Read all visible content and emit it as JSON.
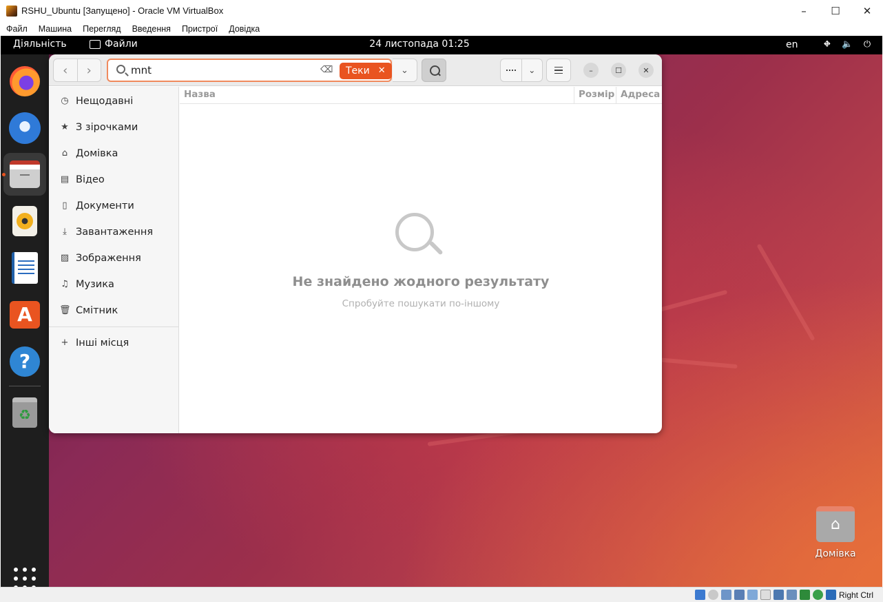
{
  "host": {
    "title": "RSHU_Ubuntu [Запущено] - Oracle VM VirtualBox",
    "window_controls": {
      "minimize": "–",
      "maximize": "☐",
      "close": "✕"
    },
    "menu": [
      "Файл",
      "Машина",
      "Перегляд",
      "Введення",
      "Пристрої",
      "Довідка"
    ],
    "status": {
      "host_key": "Right Ctrl"
    }
  },
  "topbar": {
    "activities": "Діяльність",
    "app_name": "Файли",
    "clock": "24 листопада  01:25",
    "lang": "en"
  },
  "dock": {
    "apps": [
      "firefox-icon",
      "thunderbird-icon",
      "files-icon",
      "rhythmbox-icon",
      "libreoffice-writer-icon",
      "app-center-icon",
      "help-icon",
      "trash-icon"
    ],
    "show_apps": "apps-grid-icon"
  },
  "files": {
    "search": {
      "value": "mnt",
      "chip": "Теки"
    },
    "sidebar": [
      {
        "label": "Нещодавні",
        "icon": "recent-icon"
      },
      {
        "label": "З зірочками",
        "icon": "star-icon"
      },
      {
        "label": "Домівка",
        "icon": "home-icon"
      },
      {
        "label": "Відео",
        "icon": "video-icon"
      },
      {
        "label": "Документи",
        "icon": "documents-icon"
      },
      {
        "label": "Завантаження",
        "icon": "download-icon"
      },
      {
        "label": "Зображення",
        "icon": "pictures-icon"
      },
      {
        "label": "Музика",
        "icon": "music-icon"
      },
      {
        "label": "Смітник",
        "icon": "trash-icon"
      }
    ],
    "other_places": "Інші місця",
    "columns": {
      "name": "Назва",
      "size": "Розмір",
      "address": "Адреса"
    },
    "empty": {
      "title": "Не знайдено жодного результату",
      "subtitle": "Спробуйте пошукати по-іншому"
    }
  },
  "desktop": {
    "home_label": "Домівка"
  },
  "colors": {
    "accent": "#e95420",
    "dock_bg": "#1e1e1e",
    "topbar_bg": "#000000"
  }
}
